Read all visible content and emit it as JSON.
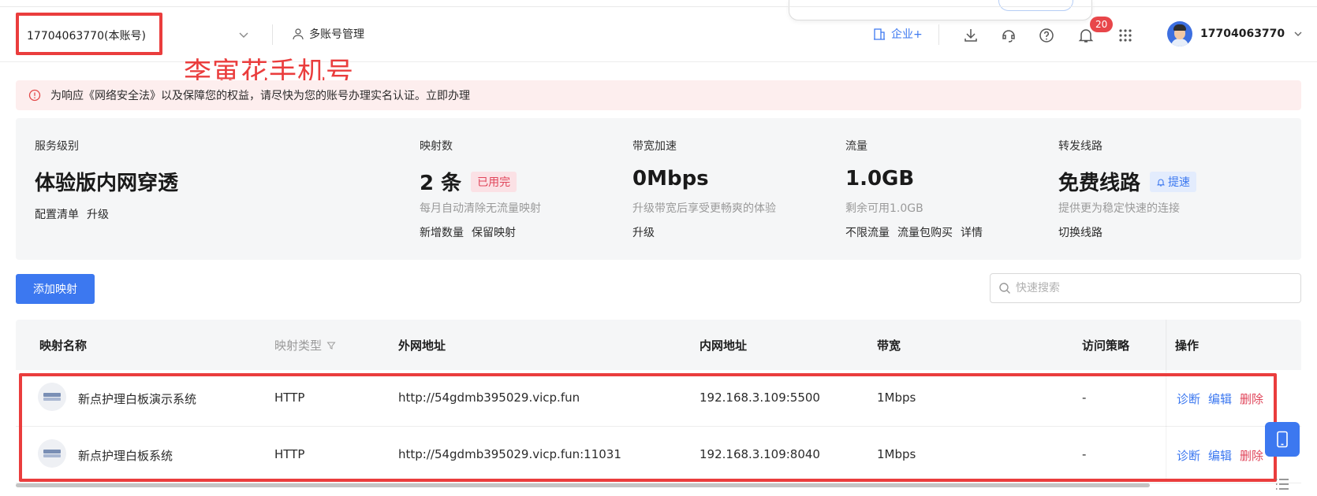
{
  "header": {
    "account_value": "17704063770(本账号)",
    "multi_account_label": "多账号管理",
    "enterprise_label": "企业+",
    "notification_count": "20",
    "username": "17704063770"
  },
  "annotation": {
    "label": "李寅花手机号"
  },
  "alert": {
    "text": "为响应《网络安全法》以及保障您的权益，请尽快为您的账号办理实名认证。立即办理"
  },
  "summary": {
    "service": {
      "label": "服务级别",
      "value": "体验版内网穿透",
      "links": [
        "配置清单",
        "升级"
      ]
    },
    "mappings": {
      "label": "映射数",
      "value": "2 条",
      "tag": "已用完",
      "desc": "每月自动清除无流量映射",
      "links": [
        "新增数量",
        "保留映射"
      ]
    },
    "bandwidth": {
      "label": "带宽加速",
      "value": "0Mbps",
      "desc": "升级带宽后享受更畅爽的体验",
      "links": [
        "升级"
      ]
    },
    "traffic": {
      "label": "流量",
      "value": "1.0GB",
      "desc": "剩余可用1.0GB",
      "links": [
        "不限流量",
        "流量包购买",
        "详情"
      ]
    },
    "route": {
      "label": "转发线路",
      "value": "免费线路",
      "tag": "提速",
      "desc": "提供更为稳定快速的连接",
      "links": [
        "切换线路"
      ]
    }
  },
  "actions": {
    "add_label": "添加映射",
    "search_placeholder": "快速搜索"
  },
  "table": {
    "headers": {
      "name": "映射名称",
      "type": "映射类型",
      "external": "外网地址",
      "internal": "内网地址",
      "bandwidth": "带宽",
      "policy": "访问策略",
      "ops": "操作"
    },
    "rows": [
      {
        "name": "新点护理白板演示系统",
        "type": "HTTP",
        "external": "http://54gdmb395029.vicp.fun",
        "internal": "192.168.3.109:5500",
        "bandwidth": "1Mbps",
        "policy": "-"
      },
      {
        "name": "新点护理白板系统",
        "type": "HTTP",
        "external": "http://54gdmb395029.vicp.fun:11031",
        "internal": "192.168.3.109:8040",
        "bandwidth": "1Mbps",
        "policy": "-"
      }
    ],
    "op_labels": {
      "diagnose": "诊断",
      "edit": "编辑",
      "delete": "删除"
    }
  },
  "colors": {
    "primary": "#3c78f0",
    "danger": "#e0455a",
    "annotation": "#ea3d3d",
    "alert_bg": "#fdeeee"
  },
  "icons": [
    "chevron-down-icon",
    "user-icon",
    "building-icon",
    "download-icon",
    "headset-icon",
    "help-icon",
    "bell-icon",
    "apps-grid-icon",
    "alert-circle-icon",
    "bell-small-icon",
    "search-icon",
    "filter-icon",
    "ie-browser-icon",
    "phone-icon",
    "list-icon"
  ]
}
